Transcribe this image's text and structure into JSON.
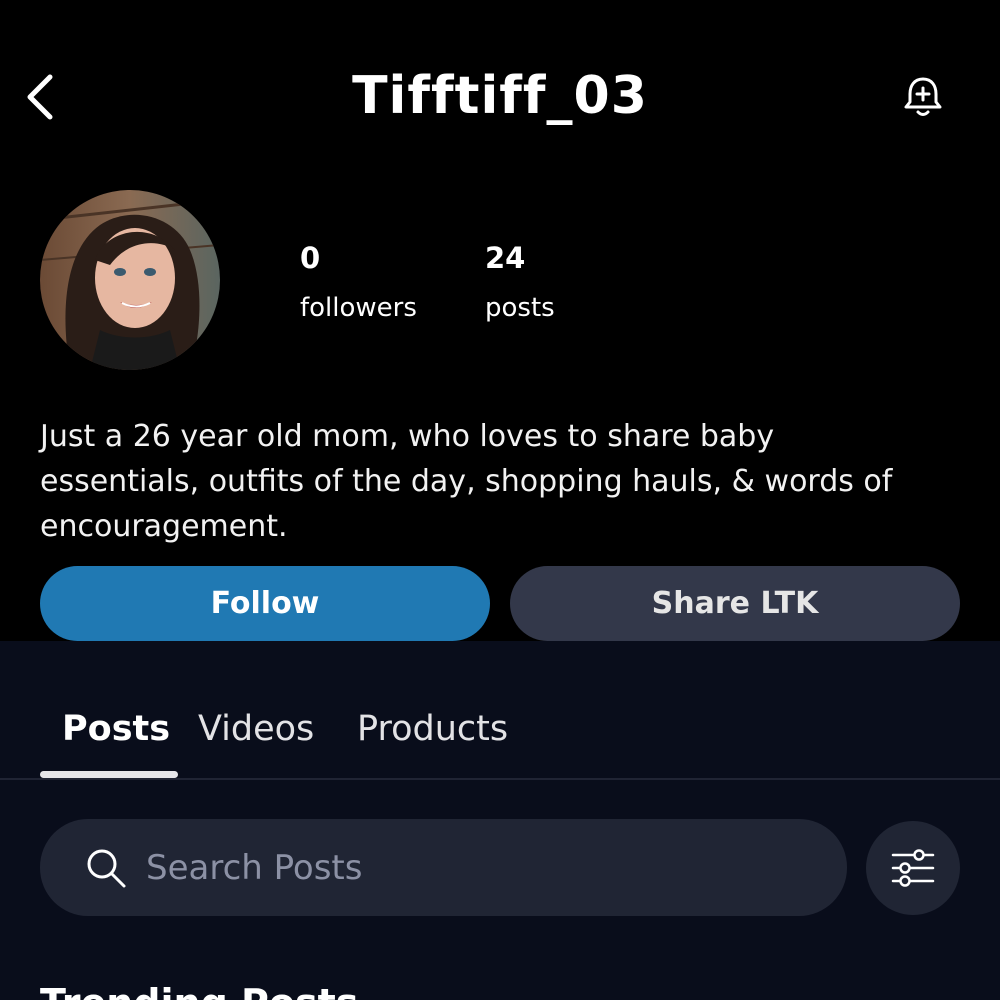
{
  "header": {
    "title": "Tifftiff_03",
    "back_icon": "chevron-left-icon",
    "notify_icon": "bell-plus-icon"
  },
  "profile": {
    "followers_count": "0",
    "followers_label": "followers",
    "posts_count": "24",
    "posts_label": "posts",
    "bio": "Just a 26 year old mom, who loves to share baby essentials, outfits of the day, shopping hauls, & words of encouragement."
  },
  "actions": {
    "follow_label": "Follow",
    "share_label": "Share LTK"
  },
  "tabs": [
    {
      "label": "Posts",
      "active": true
    },
    {
      "label": "Videos",
      "active": false
    },
    {
      "label": "Products",
      "active": false
    }
  ],
  "search": {
    "placeholder": "Search Posts"
  },
  "section": {
    "title": "Trending Posts"
  },
  "colors": {
    "background": "#000000",
    "panel": "#090d1b",
    "follow_button": "#2079b3",
    "share_button": "#33384a",
    "search_field": "#202534"
  }
}
